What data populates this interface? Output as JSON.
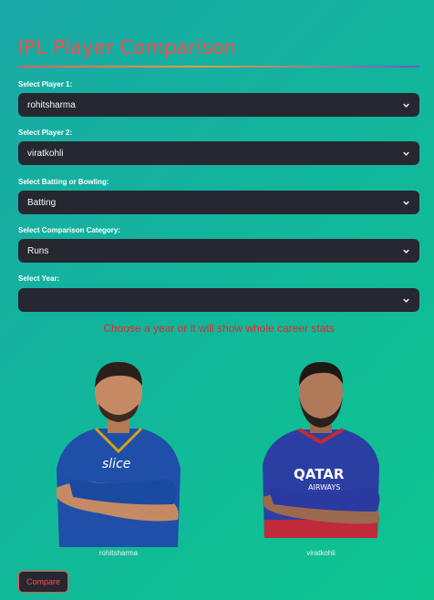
{
  "page": {
    "title": "IPL Player Comparison"
  },
  "form": {
    "player1": {
      "label": "Select Player 1:",
      "value": "rohitsharma"
    },
    "player2": {
      "label": "Select Player 2:",
      "value": "viratkohli"
    },
    "mode": {
      "label": "Select Batting or Bowling:",
      "value": "Batting"
    },
    "category": {
      "label": "Select Comparison Category:",
      "value": "Runs"
    },
    "year": {
      "label": "Select Year:",
      "value": ""
    }
  },
  "hint": "Choose a year or it will show whole career stats",
  "players": {
    "left": {
      "caption": "rohitsharma",
      "jersey_color": "#1f4fa8"
    },
    "right": {
      "caption": "viratkohli",
      "jersey_color": "#2b3fa3"
    }
  },
  "actions": {
    "compare_label": "Compare"
  },
  "colors": {
    "accent": "#ff4b4b",
    "input_bg": "#262730",
    "hint_text": "#e8262b"
  }
}
